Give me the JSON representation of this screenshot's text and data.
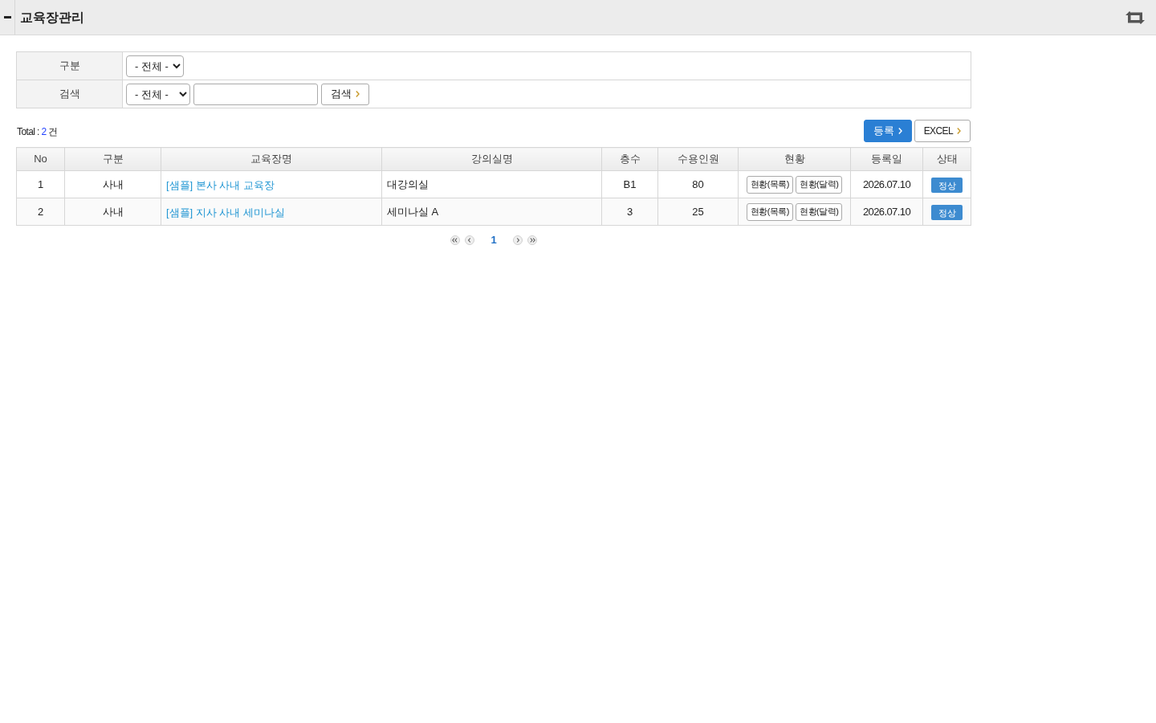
{
  "header": {
    "title": "교육장관리"
  },
  "search_form": {
    "rows": [
      {
        "label": "구분",
        "fields": [
          {
            "kind": "select",
            "value": "- 전체 -"
          }
        ]
      },
      {
        "label": "검색",
        "fields": [
          {
            "kind": "select",
            "value": "- 전체 -"
          },
          {
            "kind": "input"
          },
          {
            "kind": "button",
            "label": "검색"
          }
        ]
      }
    ]
  },
  "total": {
    "label": "Total :",
    "count": "2",
    "unit": "건"
  },
  "actions": [
    {
      "kind": "primary",
      "label": "등록"
    },
    {
      "kind": "default",
      "label": "EXCEL"
    }
  ],
  "table": {
    "columns": [
      "No",
      "구분",
      "교육장명",
      "강의실명",
      "층수",
      "수용인원",
      "현황",
      "등록일",
      "상태"
    ],
    "rows": [
      {
        "no": "1",
        "category": "사내",
        "name": "[샘플] 본사 사내 교육장",
        "room": "대강의실",
        "floor": "B1",
        "capacity": "80",
        "status_buttons": [
          "현황(목록)",
          "현황(달력)"
        ],
        "date": "2026.07.10",
        "state": "정상"
      },
      {
        "no": "2",
        "category": "사내",
        "name": "[샘플] 지사 사내 세미나실",
        "room": "세미나실 A",
        "floor": "3",
        "capacity": "25",
        "status_buttons": [
          "현황(목록)",
          "현황(달력)"
        ],
        "date": "2026.07.10",
        "state": "정상"
      }
    ]
  },
  "pagination": {
    "pages": [
      {
        "label": "1",
        "selected": true
      }
    ]
  }
}
